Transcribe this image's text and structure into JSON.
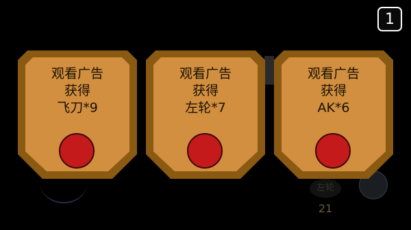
{
  "background_hint": {
    "badge_text": "左轮",
    "count": "21"
  },
  "counter": "1",
  "cards": [
    {
      "line1": "观看广告",
      "line2": "获得",
      "reward": "飞刀*9"
    },
    {
      "line1": "观看广告",
      "line2": "获得",
      "reward": "左轮*7"
    },
    {
      "line1": "观看广告",
      "line2": "获得",
      "reward": "AK*6"
    }
  ],
  "colors": {
    "card_border": "#8a5a12",
    "card_fill": "#d18f3f",
    "button": "#c41a1c"
  }
}
